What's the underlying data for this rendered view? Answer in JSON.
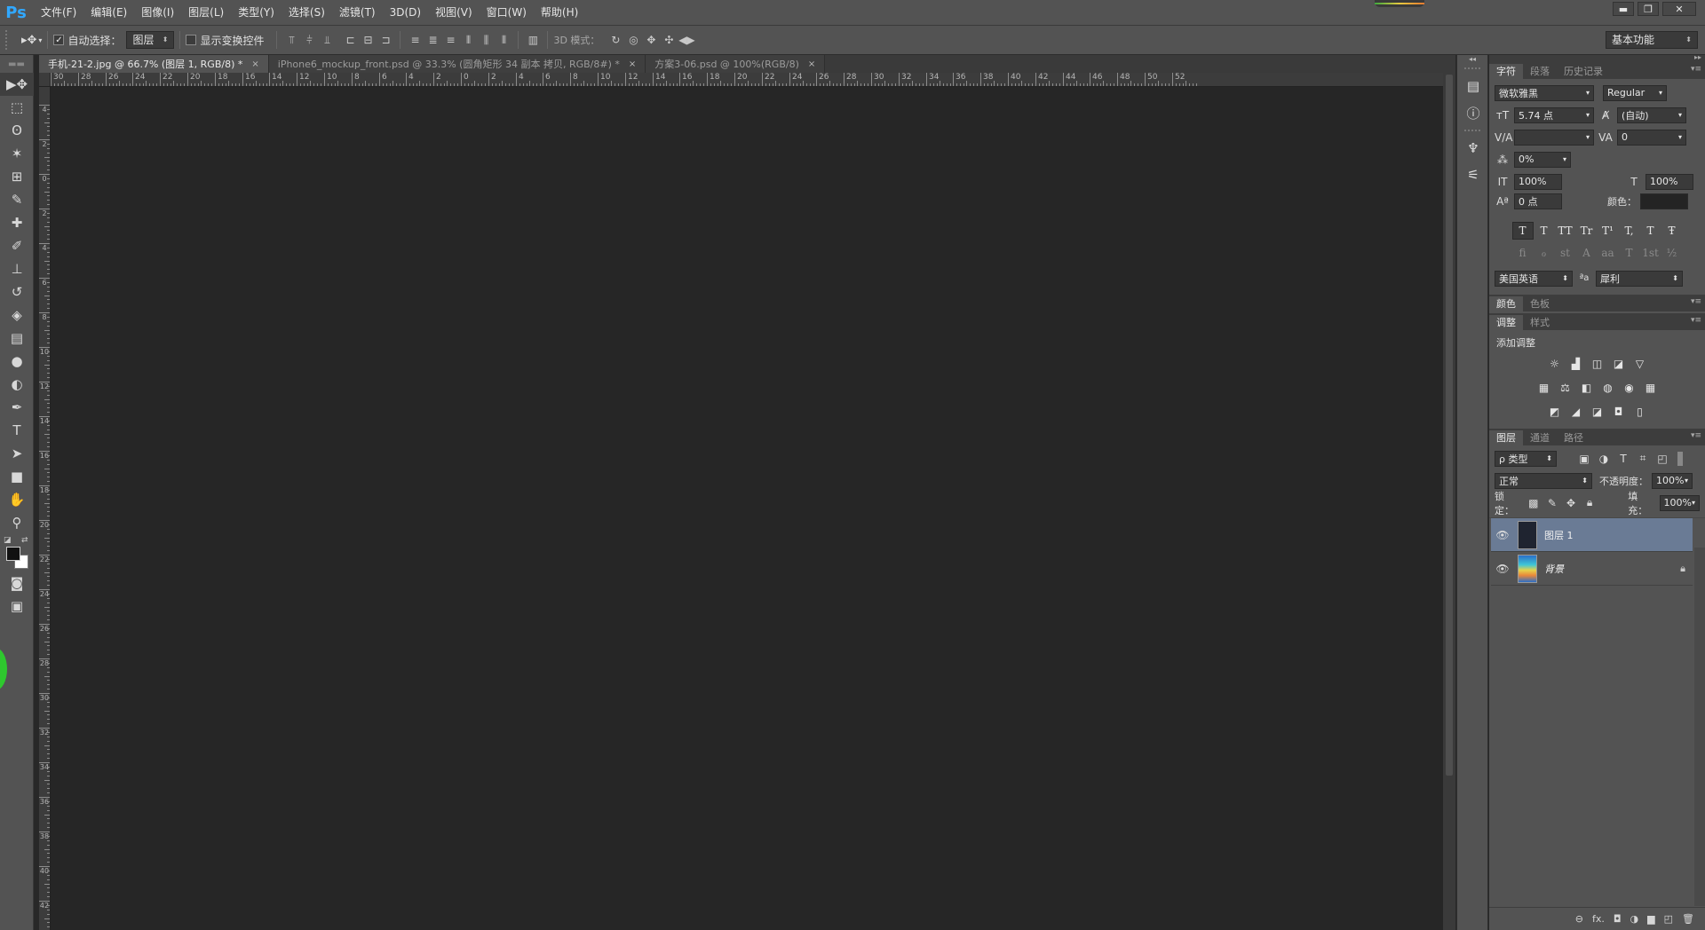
{
  "app": {
    "logo": "Ps"
  },
  "menu": [
    "文件(F)",
    "编辑(E)",
    "图像(I)",
    "图层(L)",
    "类型(Y)",
    "选择(S)",
    "滤镜(T)",
    "3D(D)",
    "视图(V)",
    "窗口(W)",
    "帮助(H)"
  ],
  "window_controls": {
    "minimize": "▬",
    "restore": "❐",
    "close": "✕"
  },
  "options": {
    "auto_select_label": "自动选择：",
    "auto_select_checked": "✓",
    "auto_select_value": "图层",
    "show_transform_label": "显示变换控件",
    "mode_3d_label": "3D 模式：",
    "workspace": "基本功能"
  },
  "tabs": [
    {
      "title": "手机-21-2.jpg @ 66.7% (图层 1, RGB/8) *",
      "close": "×"
    },
    {
      "title": "iPhone6_mockup_front.psd @ 33.3% (圆角矩形 34 副本 拷贝, RGB/8#) *",
      "close": "×"
    },
    {
      "title": "方案3-06.psd @ 100%(RGB/8)",
      "close": "×"
    }
  ],
  "ruler_h": [
    "30",
    "28",
    "26",
    "24",
    "22",
    "20",
    "18",
    "16",
    "14",
    "12",
    "10",
    "8",
    "6",
    "4",
    "2",
    "0",
    "2",
    "4",
    "6",
    "8",
    "10",
    "12",
    "14",
    "16",
    "18",
    "20",
    "22",
    "24",
    "26",
    "28",
    "30",
    "32",
    "34",
    "36",
    "38",
    "40",
    "42",
    "44",
    "46",
    "48",
    "50",
    "52"
  ],
  "ruler_v": [
    "4",
    "2",
    "0",
    "2",
    "4",
    "6",
    "8",
    "10",
    "12",
    "14",
    "16",
    "18",
    "20",
    "22",
    "24",
    "26",
    "28",
    "30",
    "32",
    "34",
    "36",
    "38",
    "40",
    "42"
  ],
  "tools": [
    {
      "name": "move-tool",
      "icon": "▶✥"
    },
    {
      "name": "marquee-tool",
      "icon": "⬚"
    },
    {
      "name": "lasso-tool",
      "icon": "ʘ"
    },
    {
      "name": "magic-wand-tool",
      "icon": "✶"
    },
    {
      "name": "crop-tool",
      "icon": "⊞"
    },
    {
      "name": "eyedropper-tool",
      "icon": "✎"
    },
    {
      "name": "healing-brush-tool",
      "icon": "✚"
    },
    {
      "name": "brush-tool",
      "icon": "✐"
    },
    {
      "name": "clone-stamp-tool",
      "icon": "⊥"
    },
    {
      "name": "history-brush-tool",
      "icon": "↺"
    },
    {
      "name": "eraser-tool",
      "icon": "◈"
    },
    {
      "name": "gradient-tool",
      "icon": "▤"
    },
    {
      "name": "blur-tool",
      "icon": "●"
    },
    {
      "name": "dodge-tool",
      "icon": "◐"
    },
    {
      "name": "pen-tool",
      "icon": "✒"
    },
    {
      "name": "type-tool",
      "icon": "T"
    },
    {
      "name": "path-selection-tool",
      "icon": "➤"
    },
    {
      "name": "rectangle-tool",
      "icon": "■"
    },
    {
      "name": "hand-tool",
      "icon": "✋"
    },
    {
      "name": "zoom-tool",
      "icon": "⚲"
    }
  ],
  "character": {
    "tabs": [
      "字符",
      "段落",
      "历史记录"
    ],
    "font_family": "微软雅黑",
    "font_style": "Regular",
    "font_size": "5.74 点",
    "leading": "(自动)",
    "kerning": "",
    "tracking": "0",
    "tsume": "0%",
    "vertical_scale": "100%",
    "horizontal_scale": "100%",
    "baseline_shift": "0 点",
    "color_label": "颜色：",
    "language": "美国英语",
    "aa_label": "ªa",
    "antialias": "犀利",
    "type_buttons": [
      "T",
      "T",
      "TT",
      "Tr",
      "T¹",
      "T,",
      "T",
      "Ŧ"
    ],
    "ot_buttons": [
      "fi",
      "ℴ",
      "st",
      "A",
      "aa",
      "T",
      "1st",
      "½"
    ]
  },
  "color_panel": {
    "tabs": [
      "颜色",
      "色板"
    ]
  },
  "adjust_panel": {
    "tabs": [
      "调整",
      "样式"
    ],
    "title": "添加调整",
    "row1": [
      "☼",
      "▟",
      "◫",
      "◪",
      "▽"
    ],
    "row2": [
      "▦",
      "⚖",
      "◧",
      "◍",
      "◉",
      "▦"
    ],
    "row3": [
      "◩",
      "◢",
      "◪",
      "◘",
      "▯"
    ]
  },
  "layers_panel": {
    "tabs": [
      "图层",
      "通道",
      "路径"
    ],
    "filter": "ρ 类型",
    "blend_mode": "正常",
    "opacity_label": "不透明度：",
    "opacity": "100%",
    "lock_label": "锁定：",
    "fill_label": "填充：",
    "fill": "100%",
    "layers": [
      {
        "name": "图层 1",
        "selected": true
      },
      {
        "name": "背景",
        "selected": false
      }
    ],
    "footer": [
      "⊖",
      "fx.",
      "◘",
      "◑",
      "▆",
      "◰",
      "🗑"
    ]
  }
}
